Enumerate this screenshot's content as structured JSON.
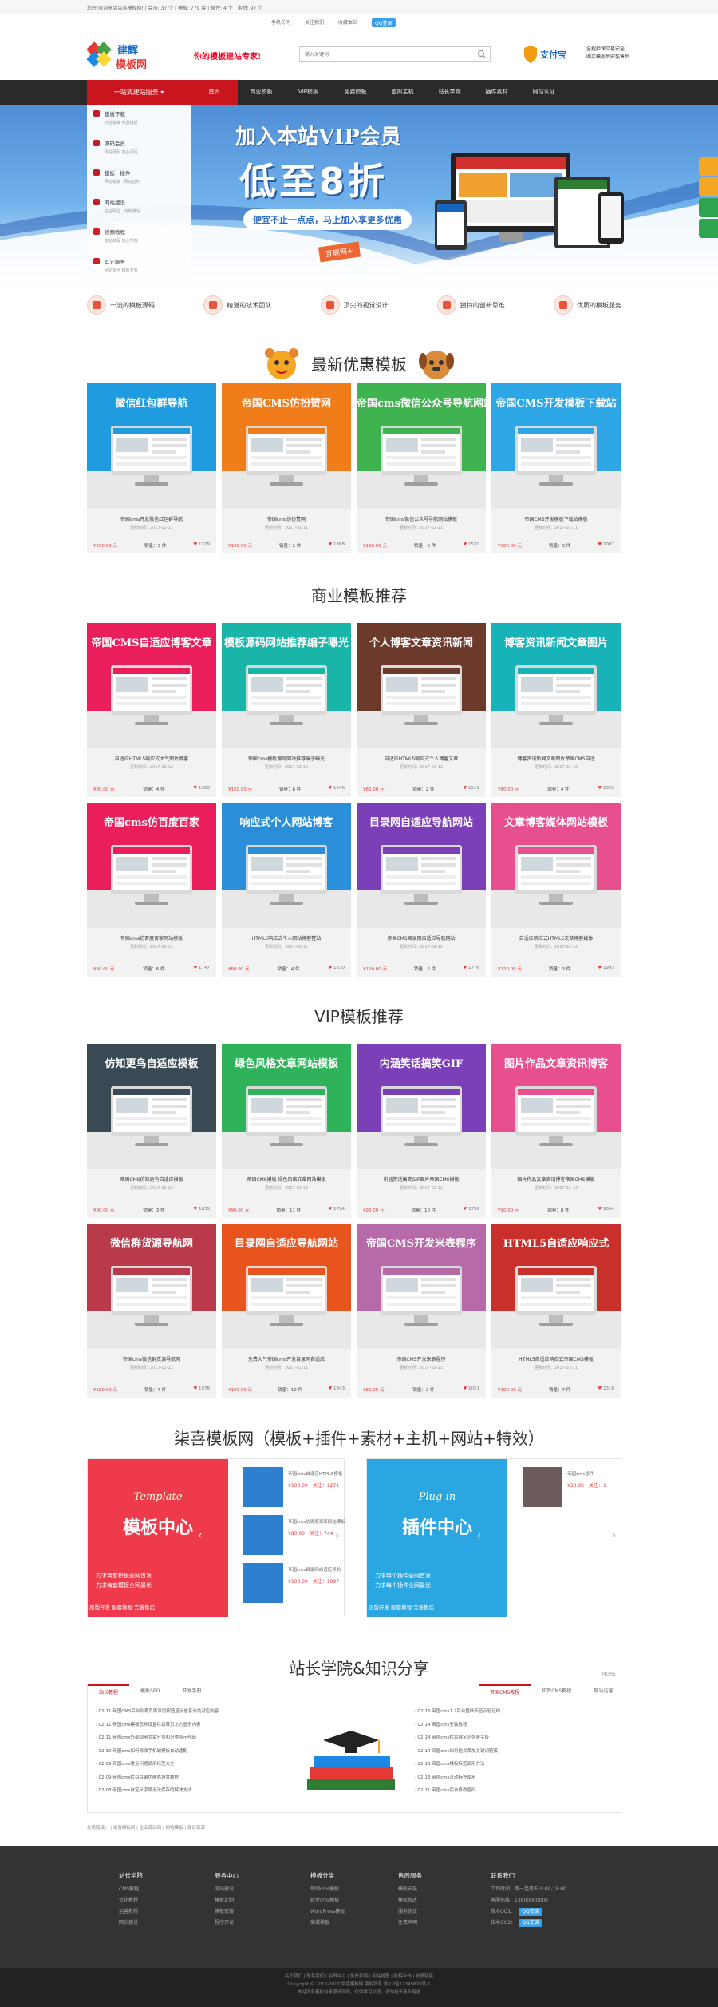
{
  "topbar": {
    "stats": "您好!欢迎来到柒喜模板网!  |  会员: 37  个  |  模板: 779  套  |  插件: 4 个  |  素材: 97 个"
  },
  "topbar2": {
    "mobile": "手机访问",
    "follow": "关注我们",
    "favorite": "收藏本站",
    "qq": "QQ登录"
  },
  "header": {
    "logo_top": "建辉",
    "logo_bottom": "模板网",
    "slogan": "你的模板建站专家!",
    "search_placeholder": "输入关键词",
    "alipay": "支付宝",
    "alipay_line1": "全程担保交易安全",
    "alipay_line2": "购买模板后安装售后"
  },
  "nav": {
    "category": "一站式建站服务 ▾",
    "items": [
      "首页",
      "商业模板",
      "VIP模板",
      "免费模板",
      "虚拟主机",
      "站长学院",
      "插件素材",
      "网站认证"
    ]
  },
  "sidemenu": [
    {
      "title": "模板下载",
      "sub": "商业模板   免费模板"
    },
    {
      "title": "源码会员",
      "sub": "网站源码   商业源码"
    },
    {
      "title": "模板 · 插件",
      "sub": "网站模板 · 网站插件"
    },
    {
      "title": "网站建设",
      "sub": "企业网站 · 定制建站"
    },
    {
      "title": "视频教程",
      "sub": "建站教程   站长学院"
    },
    {
      "title": "其它服务",
      "sub": "网站安全   模板安装"
    }
  ],
  "banner": {
    "title1": "加入本站VIP会员",
    "title2": "低至8折",
    "sub": "便宜不止一点点，马上加入享更多优惠",
    "tag": "互联网+"
  },
  "features": [
    "一流的模板源码",
    "精湛的技术团队",
    "顶尖的视觉设计",
    "独特的创新思维",
    "优质的模板服务"
  ],
  "sections": {
    "latest": "最新优惠模板",
    "business": "商业模板推荐",
    "vip": "VIP模板推荐",
    "network": "柒喜模板网（模板+插件+素材+主机+网站+特效）",
    "academy": "站长学院&知识分享"
  },
  "latest_cards": [
    {
      "head": "微信红包群导航",
      "name": "帝国cms开发微信红包群导航",
      "date": "更新时间：2017-02-11",
      "price": "¥200.00 元",
      "sales": "销量：3 件",
      "fav": "1379",
      "color": "#1f9be0"
    },
    {
      "head": "帝国CMS仿扮赞网",
      "name": "帝国cms仿扮赞网",
      "date": "更新时间：2017-02-11",
      "price": "¥100.00 元",
      "sales": "销量：2 件",
      "fav": "1868",
      "color": "#f07d1a"
    },
    {
      "head": "帝国cms微信公众号导航网站模板",
      "name": "帝国cms微信公众号导航网站模板",
      "date": "更新时间：2017-02-11",
      "price": "¥180.00 元",
      "sales": "销量：5 件",
      "fav": "1530",
      "color": "#3fb34f"
    },
    {
      "head": "帝国CMS开发模板下载站",
      "name": "帝国CMS开发模板下载站模板",
      "date": "更新时间：2017-02-11",
      "price": "¥300.00 元",
      "sales": "销量：3 件",
      "fav": "1007",
      "color": "#2da6e6"
    }
  ],
  "business_cards": [
    {
      "head": "帝国CMS自适应博客文章",
      "name": "自适应HTML5响应式大气图片博客",
      "date": "更新时间：2017-02-12",
      "price": "¥80.00 元",
      "sales": "销量：4 件",
      "fav": "1583",
      "color": "#e91e5a"
    },
    {
      "head": "模板源码网站推荐编子曝光",
      "name": "帝国cms模板源码网站推荐编子曝光",
      "date": "更新时间：2017-02-12",
      "price": "¥150.00 元",
      "sales": "销量：6 件",
      "fav": "1546",
      "color": "#19b5a8"
    },
    {
      "head": "个人博客文章资讯新闻",
      "name": "自适应HTML5响应式个人博客文章",
      "date": "更新时间：2017-02-12",
      "price": "¥80.00 元",
      "sales": "销量：2 件",
      "fav": "1519",
      "color": "#6b3a2a"
    },
    {
      "head": "博客资讯新闻文章图片",
      "name": "博客资讯新闻文章图片帝国CMS自适",
      "date": "更新时间：2017-02-12",
      "price": "¥80.00 元",
      "sales": "销量：4 件",
      "fav": "1595",
      "color": "#17b3b8"
    },
    {
      "head": "帝国cms仿百度百家",
      "name": "帝国cms仿百度百家网站模板",
      "date": "更新时间：2017-02-12",
      "price": "¥80.00 元",
      "sales": "销量：6 件",
      "fav": "1747",
      "color": "#e91e5a"
    },
    {
      "head": "响应式个人网站博客",
      "name": "HTML5响应式个人网站博客整站",
      "date": "更新时间：2017-02-12",
      "price": "¥60.00 元",
      "sales": "销量：4 件",
      "fav": "1630",
      "color": "#2a8fd8"
    },
    {
      "head": "目录网自适应导航网站",
      "name": "帝国CMS目录网自适应导航网站",
      "date": "更新时间：2017-02-12",
      "price": "¥150.00 元",
      "sales": "销量：2 件",
      "fav": "1776",
      "color": "#7b3fb8"
    },
    {
      "head": "文章博客媒体网站模板",
      "name": "自适应响应式HTML5文章博客媒体",
      "date": "更新时间：2017-02-12",
      "price": "¥120.00 元",
      "sales": "销量：3 件",
      "fav": "1993",
      "color": "#e84f8f"
    }
  ],
  "vip_cards": [
    {
      "head": "仿知更鸟自适应模板",
      "name": "帝国CMS仿知更鸟自适应模板",
      "date": "更新时间：2017-02-12",
      "price": "¥90.00 元",
      "sales": "销量：3 件",
      "fav": "1635",
      "color": "#3a4a55"
    },
    {
      "head": "绿色风格文章网站模板",
      "name": "帝国CMS模板 绿色风格文章网站模板",
      "date": "更新时间：2017-02-12",
      "price": "¥90.00 元",
      "sales": "销量：11 件",
      "fav": "1724",
      "color": "#2fb35a"
    },
    {
      "head": "内涵笑话搞笑GIF",
      "name": "内涵笑话搞笑GIF图片帝国CMS模板",
      "date": "更新时间：2017-02-12",
      "price": "¥90.00 元",
      "sales": "销量：10 件",
      "fav": "1756",
      "color": "#7b3fb8"
    },
    {
      "head": "图片作品文章资讯博客",
      "name": "图片作品文章资讯博客帝国CMS模板",
      "date": "更新时间：2017-02-12",
      "price": "¥90.00 元",
      "sales": "销量：8 件",
      "fav": "1694",
      "color": "#e84f8f"
    },
    {
      "head": "微信群货源导航网",
      "name": "帝国cms微信群货源导航网",
      "date": "更新时间：2017-02-12",
      "price": "¥150.00 元",
      "sales": "销量：7 件",
      "fav": "1978",
      "color": "#b93a4a"
    },
    {
      "head": "目录网自适应导航网站",
      "name": "免费大气帝国cms开发目录网自适应",
      "date": "更新时间：2017-02-11",
      "price": "¥100.00 元",
      "sales": "销量：10 件",
      "fav": "1843",
      "color": "#e8531e"
    },
    {
      "head": "帝国CMS开发米表程序",
      "name": "帝国CMS开发米表程序",
      "date": "更新时间：2017-02-11",
      "price": "¥80.00 元",
      "sales": "销量：2 件",
      "fav": "1051",
      "color": "#b66aa8"
    },
    {
      "head": "HTML5自适应响应式",
      "name": "HTML5自适应响应式帝国CMS模板",
      "date": "更新时间：2017-02-11",
      "price": "¥100.00 元",
      "sales": "销量：7 件",
      "fav": "1318",
      "color": "#c9302c"
    }
  ],
  "promo_left": {
    "title": "模板中心",
    "script": "Template",
    "desc1": "力求每套模板全网首发",
    "desc2": "力求每套模板全网最优",
    "foot": "原版开发  配套教程  完善售后",
    "items": [
      {
        "title": "帝国cms自适应HTML5模板",
        "price": "¥100.00",
        "fav": "关注：1271"
      },
      {
        "title": "帝国cms仿百度百家网站模板",
        "price": "¥80.00",
        "fav": "关注：744"
      },
      {
        "title": "帝国cms目录网自适应导航",
        "price": "¥100.00",
        "fav": "关注：1097"
      }
    ]
  },
  "promo_right": {
    "title": "插件中心",
    "script": "Plug-in",
    "desc1": "力求每个插件全网首发",
    "desc2": "力求每个插件全网最优",
    "foot": "正版开发  配套教程  完善售后",
    "items": [
      {
        "title": "帝国cms插件",
        "price": "¥30.00",
        "fav": "关注：1"
      }
    ]
  },
  "academy": {
    "left_tabs": [
      "站长教程",
      "模板SEO",
      "开发手册"
    ],
    "right_tabs": [
      "帝国CMS教程",
      "织梦CMS教程",
      "网站运营"
    ],
    "more": "MORE",
    "left_news": [
      "02-11  帝国CMS后台列表页面添加按钮显示信息分类对应内容",
      "02-11  帝国cms模板怎样设置栏目首页上方显示内容",
      "02-11  帝国cms外部调用文章分页和分类显示代码",
      "02-10  帝国cms如何修改手机端模板自动适配",
      "02-09  帝国cms常见问题调用标签大全",
      "02-09  帝国cms栏目目录伪静态设置教程",
      "02-08  帝国cms自定义字段无法保存的解决方法"
    ],
    "right_news": [
      "02-16  帝国cms7.2后台登陆不显示验证码",
      "02-14  帝国cms安装教程",
      "02-14  帝国cms栏目自定义列表字段",
      "02-14  帝国cms如何给文章加关键词链接",
      "02-13  帝国cms模板标签调用方法",
      "02-13  帝国cms灵动标签使用",
      "02-11  帝国cms后台修改密码"
    ]
  },
  "friend_links": "友情链接：  |  柒喜模板网  |  企业源码网  |  网站模板  |  源码资源",
  "footer": {
    "cols": [
      {
        "head": "站长学院",
        "items": [
          "CMS教程",
          "优化教程",
          "运营教程",
          "网站建设"
        ]
      },
      {
        "head": "服务中心",
        "items": [
          "网站建设",
          "模板定制",
          "模板安装",
          "程序开发"
        ]
      },
      {
        "head": "模板分类",
        "items": [
          "帝国cms模板",
          "织梦cms模板",
          "WordPress模板",
          "商城模板"
        ]
      },
      {
        "head": "售后服务",
        "items": [
          "模板安装",
          "模板修改",
          "服务协议",
          "免责声明"
        ]
      }
    ],
    "contact_head": "联系我们",
    "contact": [
      "工作时间：周一至周五 9:00-18:00",
      "客服热线：13800000000",
      "技术QQ1：",
      "技术QQ2："
    ],
    "qq": "QQ交谈"
  },
  "copyright": {
    "line1": "关于我们  |  联系我们  |  会员中心  |  免责声明  |  网站地图  |  投稿合作  |  友情链接",
    "line2": "Copyright © 2010-2017 柒喜模板网 版权所有 粤ICP备12345678号-1",
    "line3": "本站所有模板均来源于网络，仅供学习交流，请勿用于商业用途"
  }
}
